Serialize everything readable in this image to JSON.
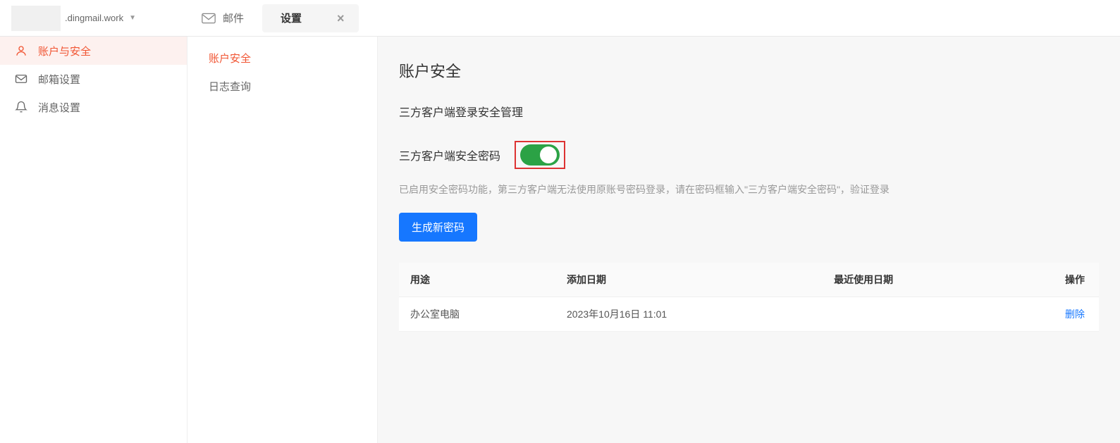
{
  "header": {
    "domain": ".dingmail.work",
    "tabs": [
      {
        "label": "邮件"
      },
      {
        "label": "设置"
      }
    ]
  },
  "sidebar": {
    "items": [
      {
        "label": "账户与安全"
      },
      {
        "label": "邮箱设置"
      },
      {
        "label": "消息设置"
      }
    ]
  },
  "subnav": {
    "items": [
      {
        "label": "账户安全"
      },
      {
        "label": "日志查询"
      }
    ]
  },
  "content": {
    "page_title": "账户安全",
    "section_title": "三方客户端登录安全管理",
    "toggle_label": "三方客户端安全密码",
    "toggle_on": true,
    "hint": "已启用安全密码功能，第三方客户端无法使用原账号密码登录，请在密码框输入\"三方客户端安全密码\"，验证登录",
    "generate_btn": "生成新密码",
    "table": {
      "headers": {
        "usage": "用途",
        "added": "添加日期",
        "last_used": "最近使用日期",
        "action": "操作"
      },
      "rows": [
        {
          "usage": "办公室电脑",
          "added": "2023年10月16日 11:01",
          "last_used": "",
          "action": "删除"
        }
      ]
    }
  }
}
